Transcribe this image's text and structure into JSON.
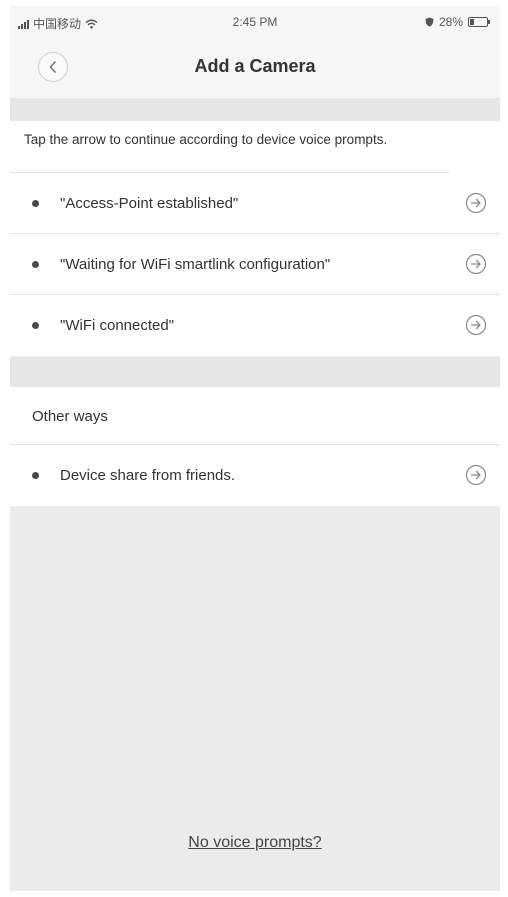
{
  "status_bar": {
    "carrier": "中国移动",
    "time": "2:45 PM",
    "battery": "28%",
    "battery_level": 0.28,
    "icons": [
      "signal-icon",
      "wifi-icon",
      "shield-icon",
      "battery-icon"
    ]
  },
  "nav": {
    "title": "Add a Camera",
    "back_icon": "chevron-left-icon"
  },
  "instruction": "Tap the arrow to continue according to device voice prompts.",
  "prompts": [
    {
      "label": "\"Access-Point established\"",
      "icon": "arrow-right-circle-icon"
    },
    {
      "label": "\"Waiting for WiFi smartlink configuration\"",
      "icon": "arrow-right-circle-icon"
    },
    {
      "label": "\"WiFi connected\"",
      "icon": "arrow-right-circle-icon"
    }
  ],
  "other_ways": {
    "header": "Other ways",
    "items": [
      {
        "label": "Device share from friends.",
        "icon": "arrow-right-circle-icon"
      }
    ]
  },
  "footer_link": "No voice prompts?",
  "colors": {
    "background": "#efefef",
    "card": "#ffffff",
    "text": "#333333",
    "divider": "#e4e4e4"
  }
}
